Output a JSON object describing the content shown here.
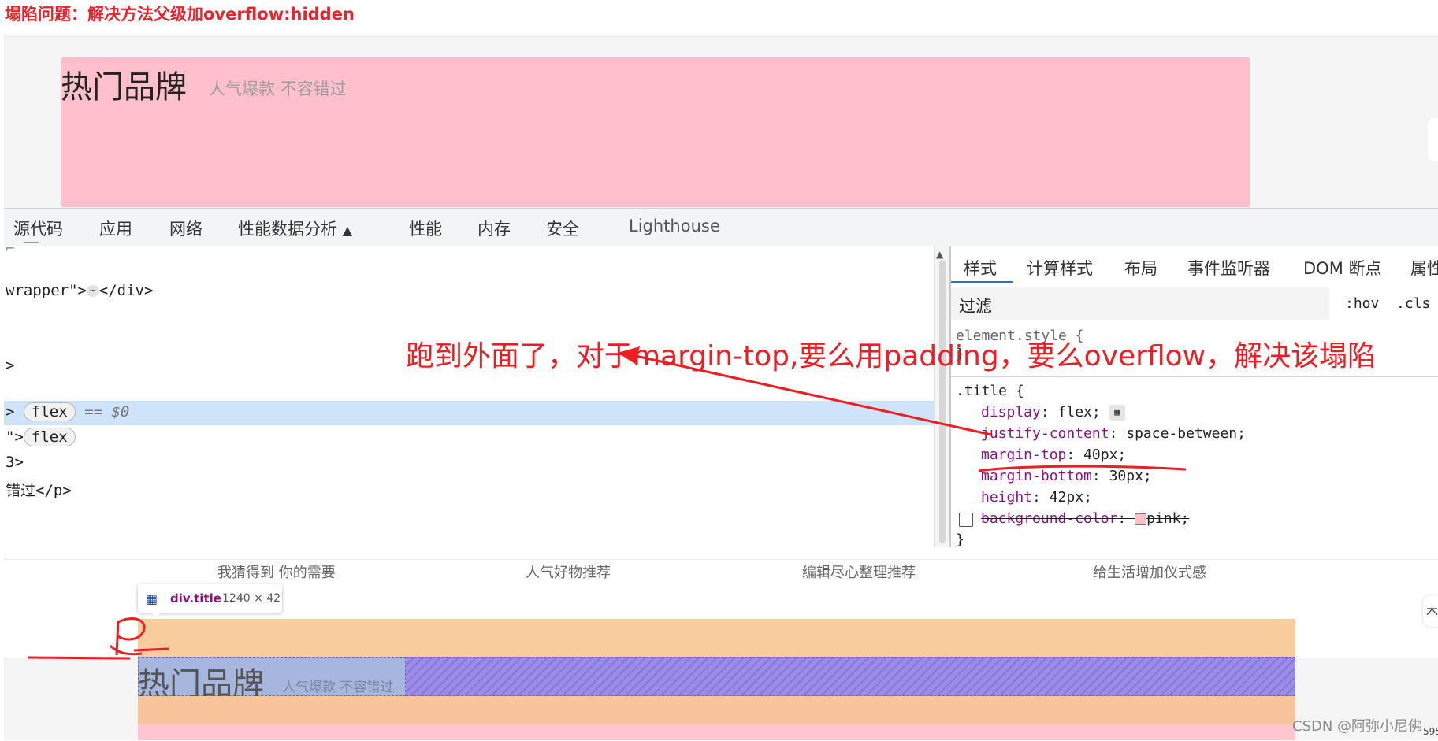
{
  "header": {
    "title": "塌陷问题：解决方法父级加overflow:hidden"
  },
  "preview": {
    "title": "热门品牌",
    "subtitle": "人气爆款 不容错过"
  },
  "devtools": {
    "tabs": [
      "源代码",
      "应用",
      "网络",
      "性能数据分析",
      "性能",
      "内存",
      "安全",
      "Lighthouse"
    ],
    "tab_flask_icon": "flask-icon"
  },
  "elements_panel": {
    "line1": "wrapper\">",
    "line1_close": "</div>",
    "line1_ellipsis": "⋯",
    "line2": ">",
    "line3_prefix": ">",
    "line3_badge": "flex",
    "line3_eq": "== $0",
    "line4_prefix": "\">",
    "line4_badge": "flex",
    "line5": "3>",
    "line6": "错过</p>"
  },
  "styles_panel": {
    "tabs": [
      "样式",
      "计算样式",
      "布局",
      "事件监听器",
      "DOM 断点",
      "属性"
    ],
    "filter": "过滤",
    "hov": ":hov",
    "cls": ".cls",
    "element_style": "element.style {",
    "brace_close": "}",
    "selector": ".title {",
    "declarations": [
      {
        "prop": "display",
        "value": "flex;"
      },
      {
        "prop": "justify-content",
        "value": "space-between;"
      },
      {
        "prop": "margin-top",
        "value": "40px;"
      },
      {
        "prop": "margin-bottom",
        "value": "30px;"
      },
      {
        "prop": "height",
        "value": "42px;"
      },
      {
        "prop": "background-color",
        "value": "pink;"
      }
    ]
  },
  "lower_preview": {
    "nav": [
      "我猜得到 你的需要",
      "人气好物推荐",
      "编辑尽心整理推荐",
      "给生活增加仪式感"
    ],
    "title": "热门品牌",
    "subtitle": "人气爆款 不容错过",
    "tooltip": {
      "name": "div.title",
      "size": "1240 × 42"
    },
    "annotation_letter": "P",
    "right_tag": "木"
  },
  "annotation": "跑到外面了，对于margin-top,要么用padding，要么overflow，解决该塌陷",
  "watermark": "CSDN @阿弥小尼佛",
  "corner_number": "595",
  "colors": {
    "accent_red": "#ee1d23",
    "pink": "#ffc0cb",
    "selection_blue": "#cfe3fa",
    "devtools_blue": "#1a73e8"
  }
}
